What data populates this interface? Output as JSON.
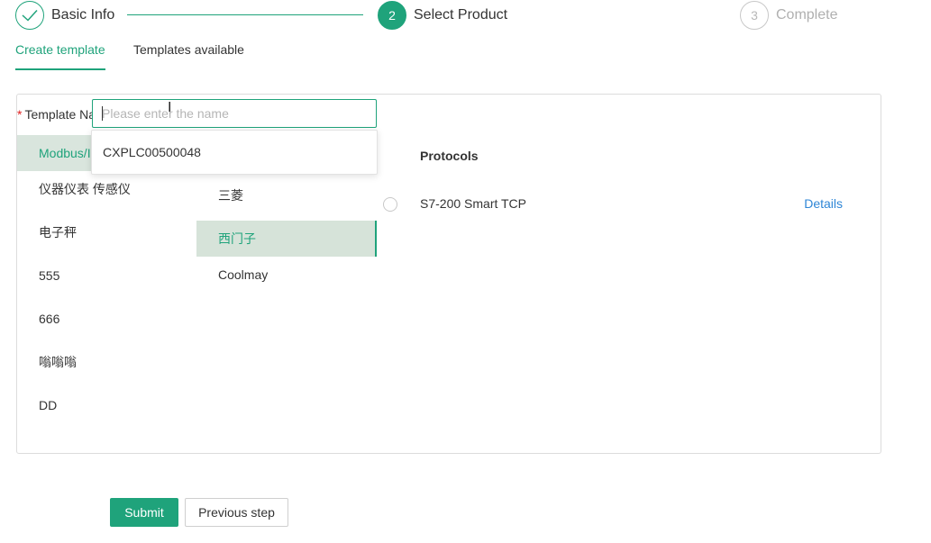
{
  "steps": [
    {
      "number": "1",
      "title": "Basic Info",
      "state": "done",
      "icon": "check-icon"
    },
    {
      "number": "2",
      "title": "Select Product",
      "state": "active"
    },
    {
      "number": "3",
      "title": "Complete",
      "state": "pending"
    }
  ],
  "tabs": [
    {
      "label": "Create template",
      "active": true
    },
    {
      "label": "Templates available",
      "active": false
    }
  ],
  "form": {
    "required_mark": "*",
    "template_name_label": "Template Na",
    "template_name_placeholder": "Please enter the name",
    "template_name_value": ""
  },
  "autocomplete": {
    "options": [
      "CXPLC00500048"
    ]
  },
  "categories": [
    "Modbus/I",
    "仪器仪表 传感仪",
    "电子秤",
    "555",
    "666",
    "嗡嗡嗡",
    "DD"
  ],
  "selected_category": "Modbus/I",
  "brands": [
    "三菱",
    "西门子",
    "Coolmay"
  ],
  "selected_brand": "西门子",
  "protocols": {
    "header": "Protocols",
    "items": [
      {
        "name": "S7-200 Smart TCP",
        "details_label": "Details",
        "selected": false
      }
    ]
  },
  "actions": {
    "submit_label": "Submit",
    "previous_label": "Previous step"
  },
  "colors": {
    "accent": "#1fa37b",
    "link": "#2f86d6",
    "selected_bg": "#d9e5dd",
    "required": "#e02020"
  }
}
